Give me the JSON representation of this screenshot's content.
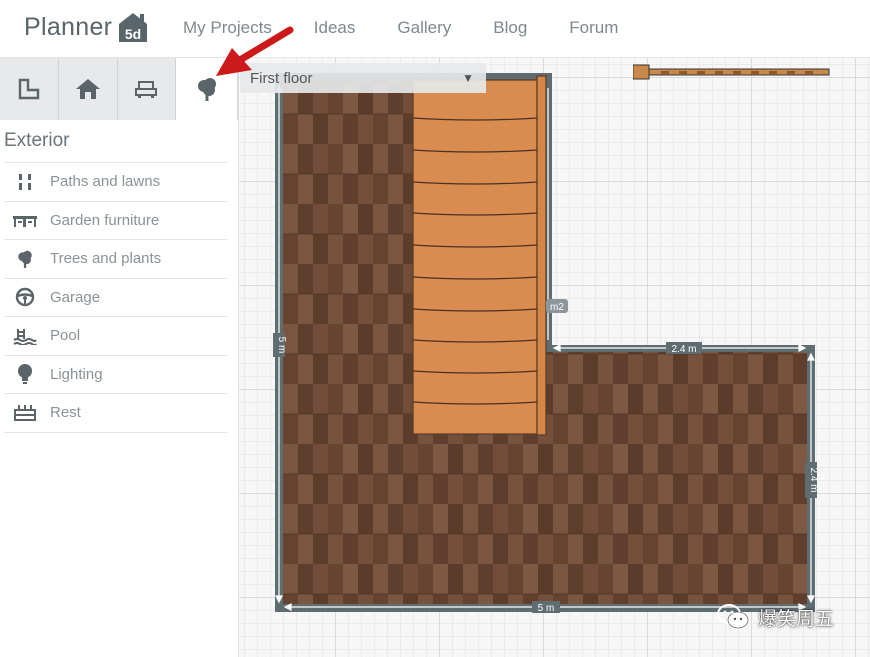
{
  "brand": {
    "name": "Planner",
    "badge": "5d"
  },
  "nav": [
    {
      "label": "My Projects"
    },
    {
      "label": "Ideas"
    },
    {
      "label": "Gallery"
    },
    {
      "label": "Blog"
    },
    {
      "label": "Forum"
    }
  ],
  "tabs": [
    {
      "icon": "floor-plan-icon"
    },
    {
      "icon": "house-icon"
    },
    {
      "icon": "furniture-icon"
    },
    {
      "icon": "tree-icon",
      "active": true
    }
  ],
  "sidebar": {
    "title": "Exterior",
    "items": [
      {
        "label": "Paths and lawns",
        "icon": "path-icon"
      },
      {
        "label": "Garden furniture",
        "icon": "garden-furniture-icon"
      },
      {
        "label": "Trees and plants",
        "icon": "tree-icon"
      },
      {
        "label": "Garage",
        "icon": "steering-wheel-icon"
      },
      {
        "label": "Pool",
        "icon": "pool-icon"
      },
      {
        "label": "Lighting",
        "icon": "bulb-icon"
      },
      {
        "label": "Rest",
        "icon": "rest-icon"
      }
    ]
  },
  "floor_select": {
    "value": "First floor"
  },
  "dimensions": {
    "left": "5 m",
    "bottom": "5 m",
    "top_right": "2.4 m",
    "right": "2.4 m",
    "inner_fragment": "m2"
  },
  "watermark": {
    "text": "爆笑周五"
  },
  "colors": {
    "wall": "#5f6d71",
    "floor": "#6e4a36",
    "stairs": "#d78c4f",
    "arrow": "#cc1a1a"
  }
}
